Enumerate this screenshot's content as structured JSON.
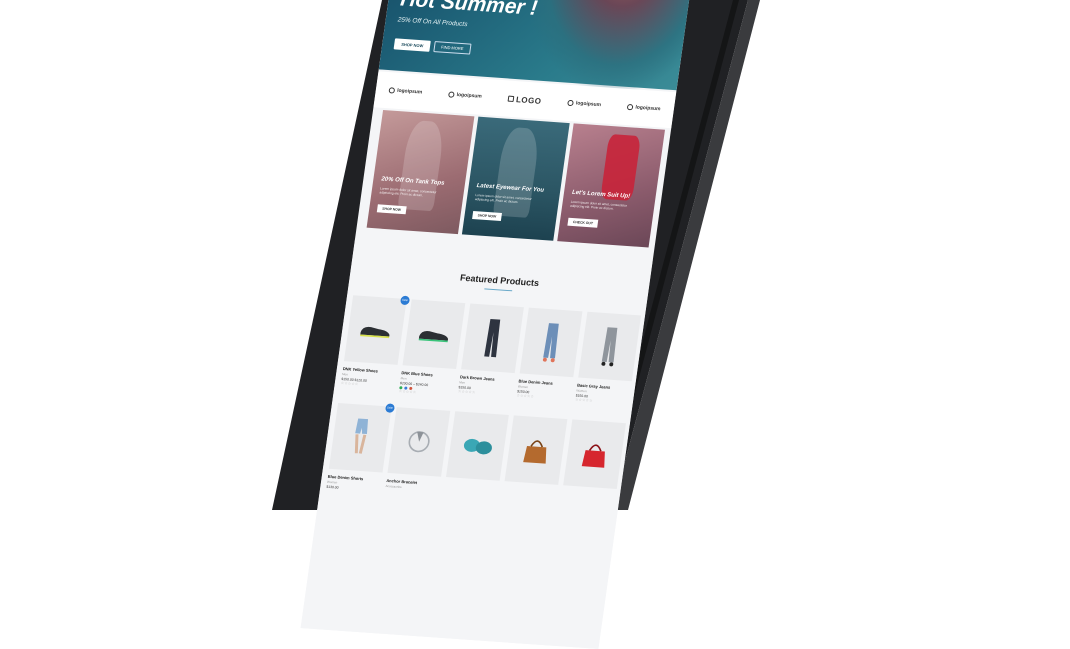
{
  "hero": {
    "title": "Hot Summer !",
    "subtitle": "25% Off On All Products",
    "primary_button": "SHOP NOW",
    "secondary_button": "FIND MORE"
  },
  "logos": [
    {
      "label": "logoipsum",
      "icon": "circle-logo-icon"
    },
    {
      "label": "logoipsum",
      "icon": "drop-logo-icon"
    },
    {
      "label": "LOGO",
      "icon": "square-logo-icon"
    },
    {
      "label": "logoipsum",
      "icon": "circle-logo-icon"
    },
    {
      "label": "logoipsum",
      "icon": "flower-logo-icon"
    }
  ],
  "promos": [
    {
      "title": "20% Off On Tank Tops",
      "text": "Lorem ipsum dolor sit amet, consectetur adipiscing elit. Proin ac dictum.",
      "button": "SHOP NOW"
    },
    {
      "title": "Latest Eyewear For You",
      "text": "Lorem ipsum dolor sit amet, consectetur adipiscing elit. Proin ac dictum.",
      "button": "SHOP NOW"
    },
    {
      "title": "Let's Lorem Suit Up!",
      "text": "Lorem ipsum dolor sit amet, consectetur adipiscing elit. Proin ac dictum.",
      "button": "CHECK OUT"
    }
  ],
  "featured": {
    "title": "Featured Products",
    "products": [
      {
        "name": "DNK Yellow Shoes",
        "category": "Men",
        "price": "$150.00 $120.00",
        "sale": "Sale!",
        "stars": "☆☆☆☆☆"
      },
      {
        "name": "DNK Blue Shoes",
        "category": "Men",
        "price": "$200.00 – $240.00",
        "sale": "",
        "stars": "☆☆☆☆☆",
        "swatches": [
          "#2fae56",
          "#3b7bd6",
          "#d2553e"
        ]
      },
      {
        "name": "Dark Brown Jeans",
        "category": "Men",
        "price": "$150.00",
        "sale": "",
        "stars": "☆☆☆☆☆"
      },
      {
        "name": "Blue Denim Jeans",
        "category": "Women",
        "price": "$150.00",
        "sale": "",
        "stars": "☆☆☆☆☆"
      },
      {
        "name": "Basic Gray Jeans",
        "category": "Women",
        "price": "$150.00",
        "sale": "",
        "stars": "☆☆☆☆☆"
      },
      {
        "name": "Blue Denim Shorts",
        "category": "Women",
        "price": "$130.00",
        "sale": "Sale!",
        "stars": ""
      },
      {
        "name": "Anchor Bracelet",
        "category": "Accessories",
        "price": "",
        "sale": "",
        "stars": ""
      },
      {
        "name": "",
        "category": "",
        "price": "",
        "sale": "",
        "stars": ""
      },
      {
        "name": "",
        "category": "",
        "price": "",
        "sale": "",
        "stars": ""
      },
      {
        "name": "",
        "category": "",
        "price": "",
        "sale": "",
        "stars": ""
      }
    ]
  },
  "colors": {
    "device": "#1e1f21",
    "accent": "#2b7bd4",
    "hero_bg": "#1b5a72"
  }
}
